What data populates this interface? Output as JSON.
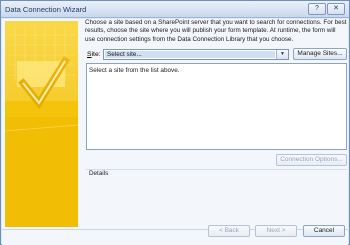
{
  "window": {
    "title": "Data Connection Wizard",
    "help_label": "?",
    "close_label": "✕"
  },
  "intro": {
    "text": "Choose a site based on a SharePoint server that you want to search for connections. For best results, choose the site where you will publish your form template. At runtime, the form will use connection settings from the Data Connection Library that you choose."
  },
  "site": {
    "label_prefix": "S",
    "label_rest": "ite:",
    "selected_value": "Select site...",
    "arrow": "▼"
  },
  "buttons": {
    "manage_sites": "Manage Sites...",
    "connection_options": "Connection Options...",
    "back": "< Back",
    "next": "Next >",
    "cancel": "Cancel"
  },
  "list": {
    "message": "Select a site from the list above."
  },
  "details": {
    "label": "Details"
  },
  "colors": {
    "banner": "#f3c20a",
    "accent": "#6f8fb8"
  }
}
